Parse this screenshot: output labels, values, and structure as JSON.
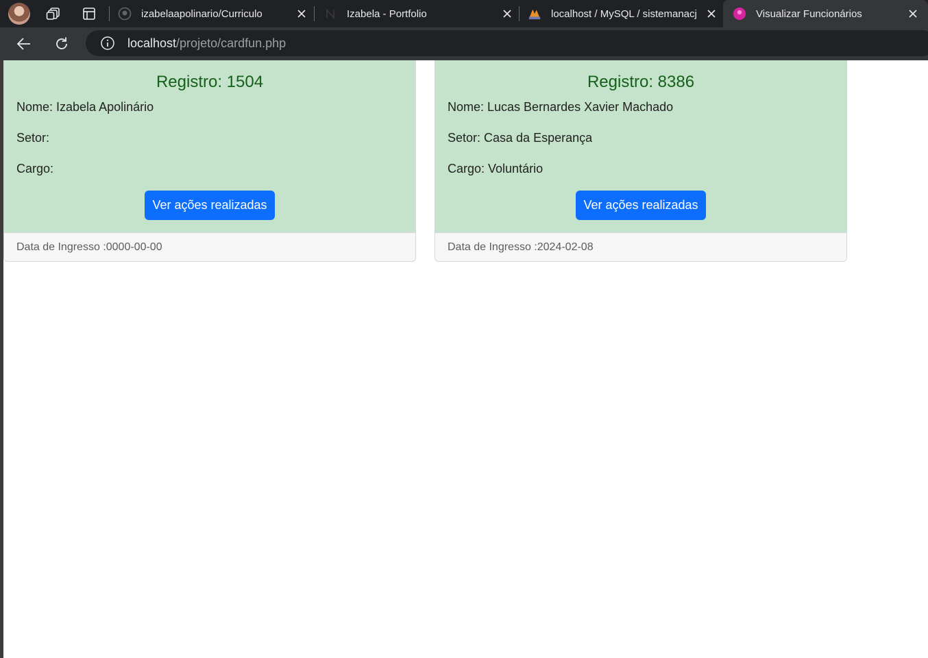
{
  "browser": {
    "tabs": [
      {
        "title": "izabelaapolinario/Curriculo",
        "favicon": "github-icon",
        "active": false
      },
      {
        "title": "Izabela - Portfolio",
        "favicon": "portfolio-icon",
        "active": false
      },
      {
        "title": "localhost / MySQL / sistemanacj",
        "favicon": "phpmyadmin-icon",
        "active": false
      },
      {
        "title": "Visualizar Funcionários",
        "favicon": "pink-site-icon",
        "active": true
      }
    ],
    "address": {
      "host": "localhost",
      "path": "/projeto/cardfun.php"
    }
  },
  "cards": [
    {
      "title": "Registro: 1504",
      "nome": "Nome: Izabela Apolinário",
      "setor": "Setor:",
      "cargo": "Cargo:",
      "button": "Ver ações realizadas",
      "footer": "Data de Ingresso :0000-00-00"
    },
    {
      "title": "Registro: 8386",
      "nome": "Nome: Lucas Bernardes Xavier Machado",
      "setor": "Setor: Casa da Esperança",
      "cargo": "Cargo: Voluntário",
      "button": "Ver ações realizadas",
      "footer": "Data de Ingresso :2024-02-08"
    }
  ],
  "colors": {
    "card_bg": "#c4e3ca",
    "title_green": "#15601a",
    "button_blue": "#0d6efd",
    "active_tab_favicon": "#d6249f"
  }
}
